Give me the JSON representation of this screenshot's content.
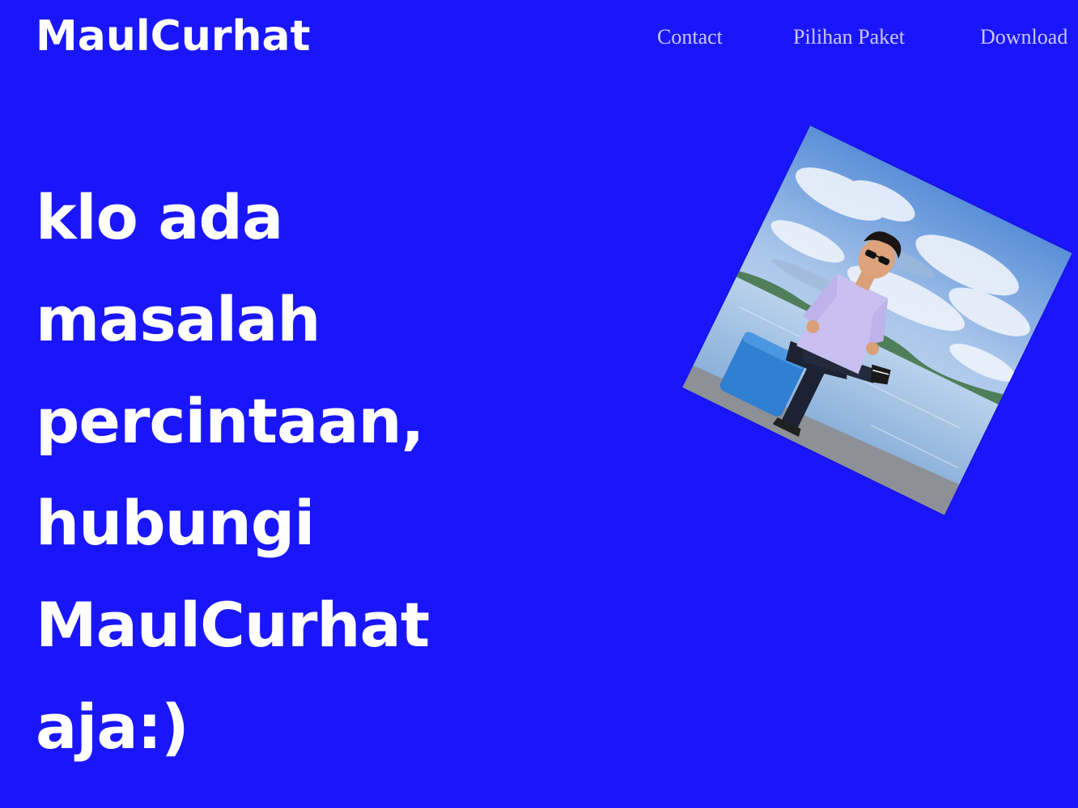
{
  "header": {
    "brand": "MaulCurhat",
    "nav": [
      {
        "label": "Contact"
      },
      {
        "label": "Pilihan Paket"
      },
      {
        "label": "Download"
      }
    ]
  },
  "hero": {
    "headline_lines": [
      "klo ada",
      "masalah",
      "percintaan,",
      "hubungi",
      "MaulCurhat",
      "aja:)"
    ],
    "photo_icon": "person-photo"
  },
  "colors": {
    "background": "#1a16fb",
    "text": "#ffffff",
    "nav_text": "#c9c7ff"
  }
}
